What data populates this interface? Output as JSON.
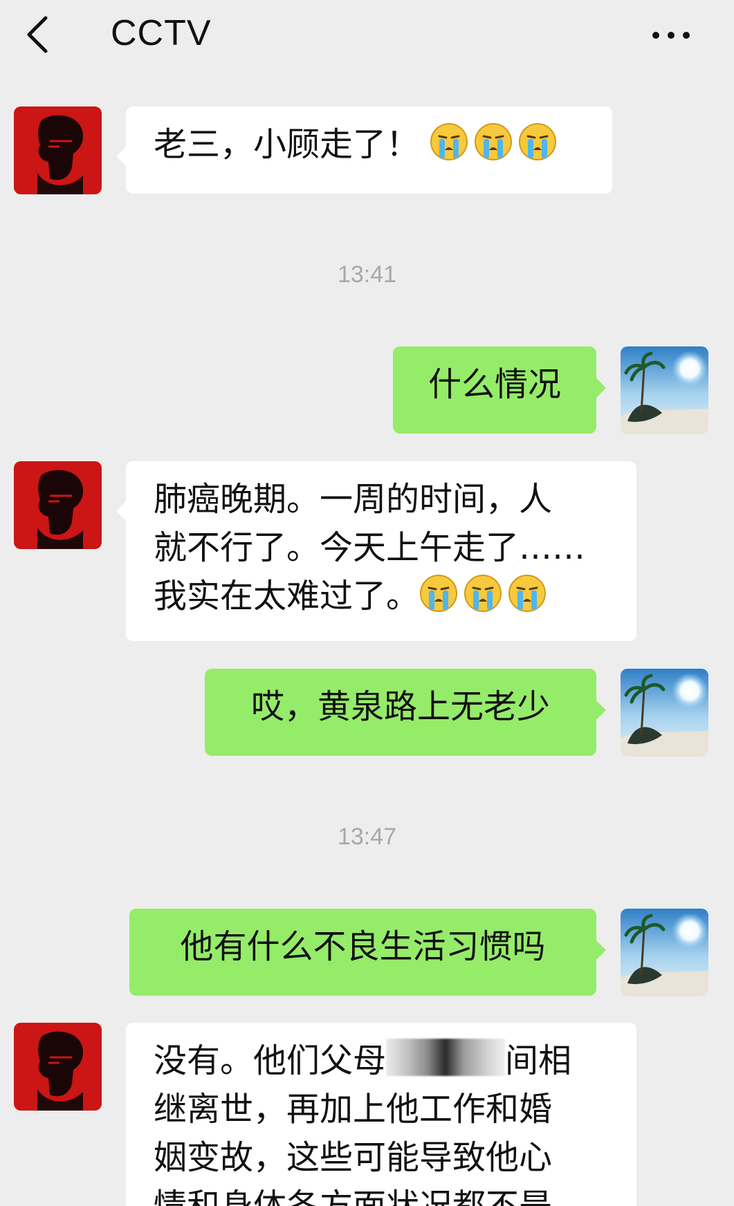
{
  "header": {
    "title": "CCTV",
    "back_icon": "chevron-left-icon",
    "more_icon": "more-dots-icon"
  },
  "messages": [
    {
      "side": "left",
      "text": "老三，小顾走了！",
      "emoji": [
        "crying-face-icon",
        "crying-face-icon",
        "crying-face-icon"
      ]
    },
    {
      "type": "time",
      "text": "13:41"
    },
    {
      "side": "right",
      "text": "什么情况"
    },
    {
      "side": "left",
      "lines": [
        "肺癌晚期。一周的时间，人",
        "就不行了。今天上午走了……",
        "我实在太难过了。"
      ],
      "emoji": [
        "crying-face-icon",
        "crying-face-icon",
        "crying-face-icon"
      ]
    },
    {
      "side": "right",
      "text": "哎，黄泉路上无老少"
    },
    {
      "type": "time",
      "text": "13:47"
    },
    {
      "side": "right",
      "text": "他有什么不良生活习惯吗"
    },
    {
      "side": "left",
      "lines": [
        "没有。他们父母",
        "间相",
        "继离世，再加上他工作和婚",
        "姻变故，这些可能导致他心",
        "情和身体各方面状况都不是"
      ]
    }
  ],
  "colors": {
    "background": "#ededed",
    "bubble_left": "#ffffff",
    "bubble_right": "#95ec69",
    "timestamp": "#a8a8a8"
  }
}
